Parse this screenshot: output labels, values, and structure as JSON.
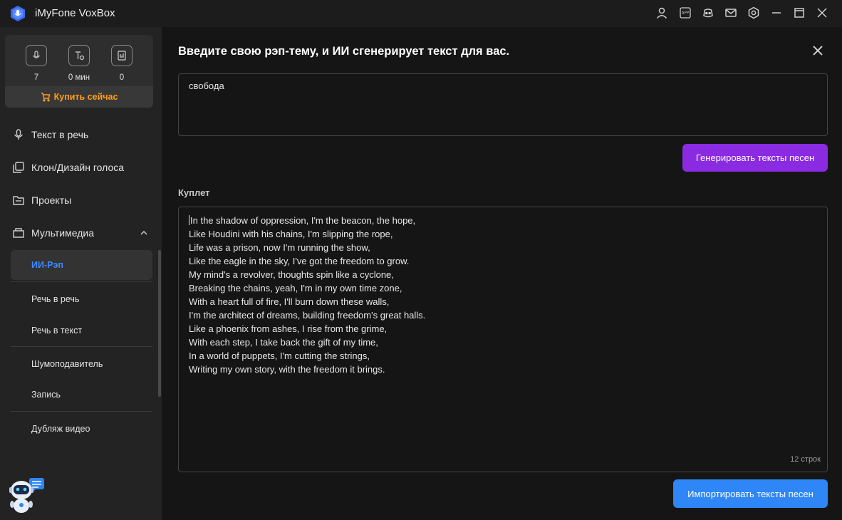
{
  "window": {
    "title": "iMyFone VoxBox",
    "icons": [
      "user-icon",
      "app-icon",
      "discord-icon",
      "mail-icon",
      "settings-icon",
      "minimize-icon",
      "maximize-icon",
      "close-icon"
    ],
    "app_icon_text": "APP"
  },
  "sidebar": {
    "stats": [
      {
        "icon": "voice-char-icon",
        "value": "7"
      },
      {
        "icon": "text-time-icon",
        "value": "0 мин"
      },
      {
        "icon": "files-icon",
        "value": "0"
      }
    ],
    "buy_label": "Купить сейчас",
    "nav": [
      {
        "label": "Текст в речь",
        "icon": "microphone-icon"
      },
      {
        "label": "Клон/Дизайн голоса",
        "icon": "clone-icon"
      },
      {
        "label": "Проекты",
        "icon": "folder-icon"
      },
      {
        "label": "Мультимедиа",
        "icon": "media-icon"
      }
    ],
    "sub_items": [
      {
        "label": "ИИ-Рэп",
        "active": true
      },
      {
        "label": "Речь в речь"
      },
      {
        "label": "Речь в текст"
      },
      {
        "label": "Шумоподавитель"
      },
      {
        "label": "Запись"
      },
      {
        "label": "Дубляж видео"
      }
    ]
  },
  "main": {
    "heading": "Введите свою рэп-тему, и ИИ сгенерирует текст для вас.",
    "topic_value": "свобода",
    "generate_label": "Генерировать тексты песен",
    "section_label": "Куплет",
    "lyrics": [
      "In the shadow of oppression, I'm the beacon, the hope,",
      "Like Houdini with his chains, I'm slipping the rope,",
      "Life was a prison, now I'm running the show,",
      "Like the eagle in the sky, I've got the freedom to grow.",
      "My mind's a revolver, thoughts spin like a cyclone,",
      "Breaking the chains, yeah, I'm in my own time zone,",
      "With a heart full of fire, I'll burn down these walls,",
      "I'm the architect of dreams, building freedom's great halls.",
      "Like a phoenix from ashes, I rise from the grime,",
      "With each step, I take back the gift of my time,",
      "In a world of puppets, I'm cutting the strings,",
      "Writing my own story, with the freedom it brings."
    ],
    "line_count": "12 строк",
    "import_label": "Импортировать тексты песен"
  },
  "colors": {
    "accent_purple": "#8a2be2",
    "accent_blue": "#2f86f6",
    "active_text": "#3d8bff",
    "buy_orange": "#ff9f1a"
  }
}
